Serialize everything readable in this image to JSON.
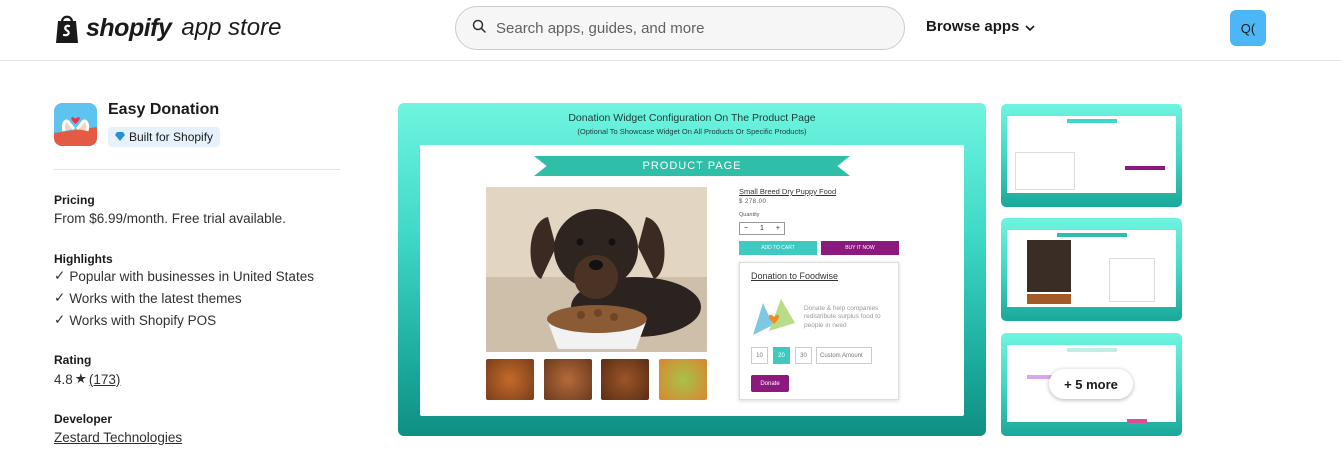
{
  "header": {
    "logo_bold": "shopify",
    "logo_light": "app store",
    "search_placeholder": "Search apps, guides, and more",
    "browse_label": "Browse apps",
    "avatar_text": "Q("
  },
  "app": {
    "name": "Easy Donation",
    "badge": "Built for Shopify",
    "pricing_title": "Pricing",
    "pricing_text": "From $6.99/month. Free trial available.",
    "highlights_title": "Highlights",
    "highlights": [
      "Popular with businesses in United States",
      "Works with the latest themes",
      "Works with Shopify POS"
    ],
    "rating_title": "Rating",
    "rating_value": "4.8",
    "rating_count": "(173)",
    "developer_title": "Developer",
    "developer_name": "Zestard Technologies"
  },
  "gallery": {
    "main_title": "Donation Widget Configuration On The Product Page",
    "main_subtitle": "(Optional To Showcase Widget On All Products Or Specific Products)",
    "ribbon": "PRODUCT PAGE",
    "product_title": "Small Breed Dry Puppy Food",
    "product_price": "$ 278.00",
    "quantity_label": "Quantity",
    "qty_minus": "−",
    "qty_value": "1",
    "qty_plus": "+",
    "add_to_cart": "ADD TO CART",
    "buy_now": "BUY IT NOW",
    "donation_title": "Donation to Foodwise",
    "donation_desc": "Donate & help companies redistribute surplus food to people in need",
    "amounts": [
      "10",
      "20",
      "30"
    ],
    "custom_amount": "Custom Amount",
    "donate_button": "Donate",
    "more_label": "+ 5 more"
  },
  "colors": {
    "accent_teal": "#3fd8c6",
    "donate_purple": "#8c1a7e",
    "avatar_blue": "#4db6f5"
  }
}
